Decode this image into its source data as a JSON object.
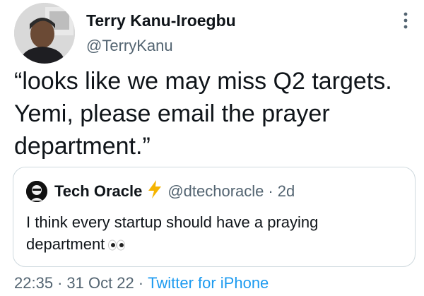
{
  "author": {
    "name": "Terry Kanu-Iroegbu",
    "handle": "@TerryKanu",
    "avatar_icon": "profile-photo"
  },
  "tweet": {
    "text": "“looks like we may miss Q2 targets. Yemi, please email the prayer department.”"
  },
  "quoted": {
    "name": "Tech Oracle",
    "badge_icon": "lightning-bolt-emoji",
    "handle": "@dtechoracle",
    "separator": "·",
    "time": "2d",
    "text": "I think every startup should have a praying department",
    "emoji_icon": "eyes-emoji"
  },
  "meta": {
    "time": "22:35",
    "sep1": "·",
    "date": "31 Oct 22",
    "sep2": "·",
    "source": "Twitter for iPhone"
  },
  "colors": {
    "text": "#0f1419",
    "secondary": "#536471",
    "link": "#1d9bf0",
    "border": "#cfd9de",
    "bolt": "#f5b400"
  }
}
